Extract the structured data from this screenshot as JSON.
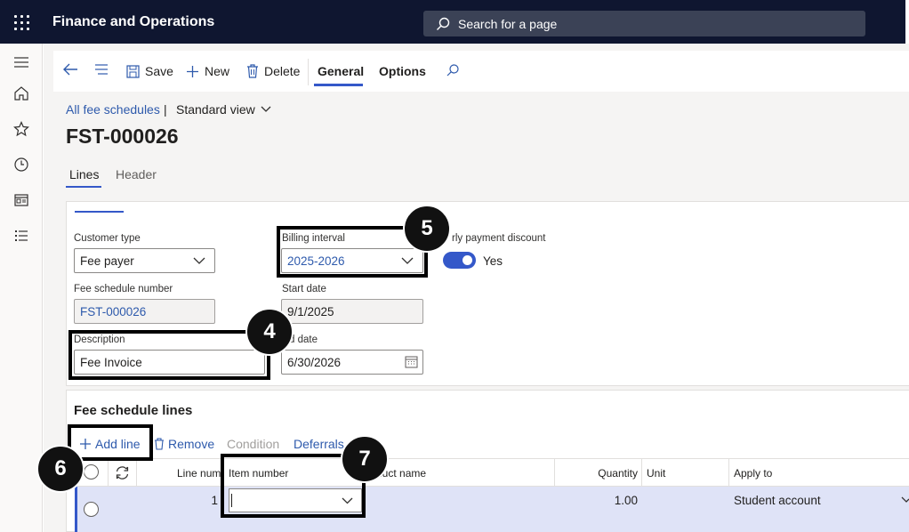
{
  "topbar": {
    "app_title": "Finance and Operations",
    "search_placeholder": "Search for a page"
  },
  "actions": {
    "save": "Save",
    "new": "New",
    "delete": "Delete",
    "general": "General",
    "options": "Options"
  },
  "breadcrumb": {
    "link": "All fee schedules",
    "separator": "|",
    "view": "Standard view"
  },
  "page_title": "FST-000026",
  "page_tabs": [
    "Lines",
    "Header"
  ],
  "header": {
    "customer_type": {
      "label": "Customer type",
      "value": "Fee payer"
    },
    "billing_interval": {
      "label": "Billing interval",
      "value": "2025-2026"
    },
    "early_payment": {
      "label": "rly payment discount",
      "value": "Yes"
    },
    "fee_schedule_number": {
      "label": "Fee schedule number",
      "value": "FST-000026"
    },
    "start_date": {
      "label": "Start date",
      "value": "9/1/2025"
    },
    "description": {
      "label": "Description",
      "value": "Fee Invoice"
    },
    "end_date": {
      "label": "d date",
      "value": "6/30/2026"
    }
  },
  "lines": {
    "title": "Fee schedule lines",
    "add_line": "Add line",
    "remove": "Remove",
    "condition": "Condition",
    "deferrals": "Deferrals",
    "columns": {
      "line_num": "Line num",
      "item_number": "Item number",
      "product_name": "duct name",
      "quantity": "Quantity",
      "unit": "Unit",
      "apply_to": "Apply to"
    },
    "rows": [
      {
        "line_num": "1",
        "item_number": "",
        "product_name": "",
        "quantity": "1.00",
        "unit": "",
        "apply_to": "Student account"
      }
    ]
  },
  "callouts": {
    "c4": "4",
    "c5": "5",
    "c6": "6",
    "c7": "7"
  },
  "colors": {
    "accent": "#3458c9",
    "topbar": "#0f1630",
    "link": "#2e5aac",
    "selected_row": "#dfe3f7"
  }
}
